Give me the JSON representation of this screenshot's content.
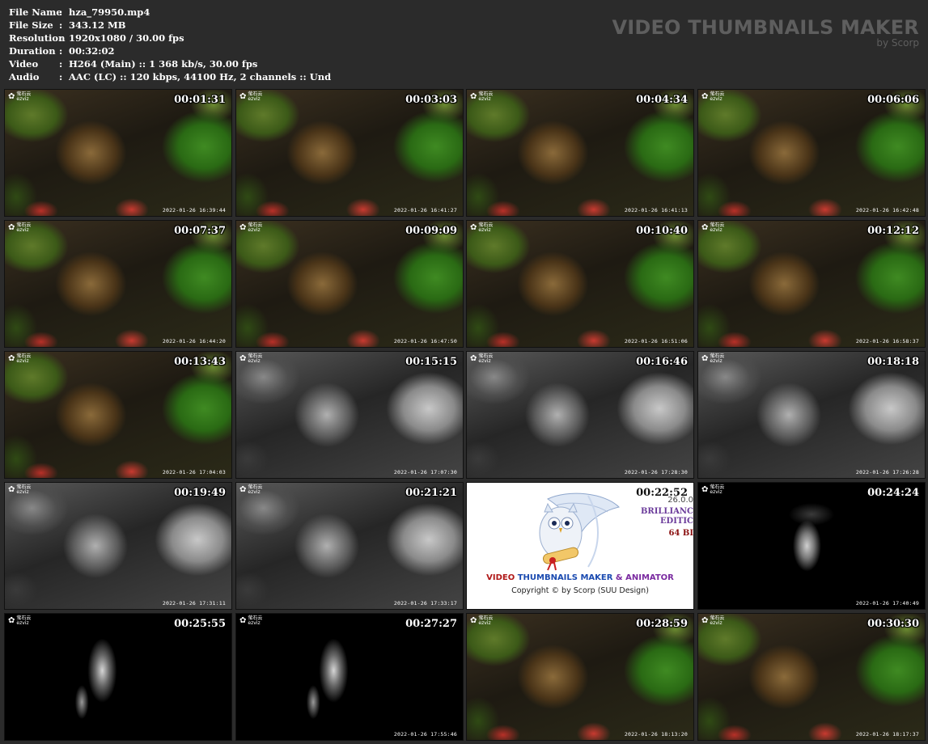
{
  "meta": [
    {
      "key": "File Name",
      "value": "hza_79950.mp4"
    },
    {
      "key": "File Size",
      "value": "343.12 MB"
    },
    {
      "key": "Resolution",
      "value": "1920x1080 / 30.00 fps"
    },
    {
      "key": "Duration",
      "value": "00:32:02"
    },
    {
      "key": "Video",
      "value": "H264 (Main) :: 1 368 kb/s, 30.00 fps"
    },
    {
      "key": "Audio",
      "value": "AAC (LC) :: 120 kbps, 44100 Hz, 2 channels :: Und"
    }
  ],
  "separator": ":",
  "brand": {
    "title": "VIDEO THUMBNAILS MAKER",
    "subtitle": "by Scorp"
  },
  "camera_logo": {
    "glyph": "✿",
    "top": "萤石云",
    "bottom": "ezviz"
  },
  "thumbnails": [
    {
      "time": "00:01:31",
      "stamp": "2022-01-26 16:39:44",
      "style": "color"
    },
    {
      "time": "00:03:03",
      "stamp": "2022-01-26 16:41:27",
      "style": "color"
    },
    {
      "time": "00:04:34",
      "stamp": "2022-01-26 16:41:13",
      "style": "color"
    },
    {
      "time": "00:06:06",
      "stamp": "2022-01-26 16:42:48",
      "style": "color"
    },
    {
      "time": "00:07:37",
      "stamp": "2022-01-26 16:44:20",
      "style": "color"
    },
    {
      "time": "00:09:09",
      "stamp": "2022-01-26 16:47:50",
      "style": "color"
    },
    {
      "time": "00:10:40",
      "stamp": "2022-01-26 16:51:06",
      "style": "color"
    },
    {
      "time": "00:12:12",
      "stamp": "2022-01-26 16:58:37",
      "style": "color"
    },
    {
      "time": "00:13:43",
      "stamp": "2022-01-26 17:04:03",
      "style": "color"
    },
    {
      "time": "00:15:15",
      "stamp": "2022-01-26 17:07:30",
      "style": "gray"
    },
    {
      "time": "00:16:46",
      "stamp": "2022-01-26 17:28:30",
      "style": "gray"
    },
    {
      "time": "00:18:18",
      "stamp": "2022-01-26 17:26:28",
      "style": "gray"
    },
    {
      "time": "00:19:49",
      "stamp": "2022-01-26 17:31:11",
      "style": "gray"
    },
    {
      "time": "00:21:21",
      "stamp": "2022-01-26 17:33:17",
      "style": "gray"
    },
    {
      "time": "00:22:52",
      "stamp": "",
      "style": "logo"
    },
    {
      "time": "00:24:24",
      "stamp": "2022-01-26 17:40:49",
      "style": "dark"
    },
    {
      "time": "00:25:55",
      "stamp": "",
      "style": "dark2"
    },
    {
      "time": "00:27:27",
      "stamp": "2022-01-26 17:55:46",
      "style": "dark2"
    },
    {
      "time": "00:28:59",
      "stamp": "2022-01-26 18:13:20",
      "style": "color"
    },
    {
      "time": "00:30:30",
      "stamp": "2022-01-26 18:17:37",
      "style": "color"
    }
  ],
  "logo_tile": {
    "line1_a": "VIDEO ",
    "line1_b": "THUMBNAILS MAKER",
    "line1_c": " & ANIMATOR",
    "line2": "Copyright © by Scorp (SUU Design)",
    "version": "26.0.0",
    "edition_1": "BRILLIANC",
    "edition_2": "EDITIC",
    "bits": "64 BI",
    "colors": {
      "red": "#b01818",
      "blue": "#1a4ab0",
      "purple": "#7a2aa0"
    }
  }
}
